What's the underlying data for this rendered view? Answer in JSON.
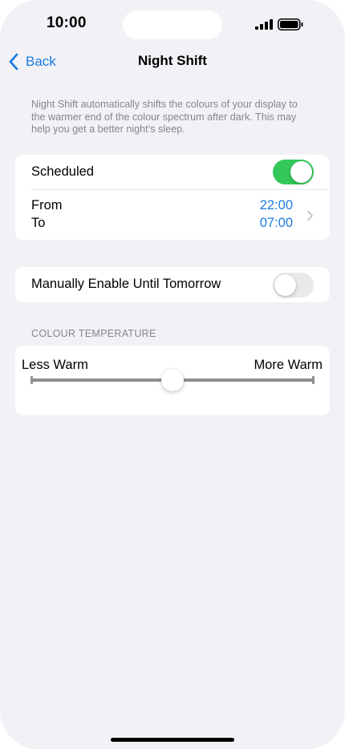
{
  "status_bar": {
    "time": "10:00"
  },
  "nav": {
    "back_label": "Back",
    "title": "Night Shift"
  },
  "description": "Night Shift automatically shifts the colours of your display to the warmer end of the colour spectrum after dark. This may help you get a better night’s sleep.",
  "schedule": {
    "label": "Scheduled",
    "enabled": true,
    "from_label": "From",
    "to_label": "To",
    "from_time": "22:00",
    "to_time": "07:00"
  },
  "manual": {
    "label": "Manually Enable Until Tomorrow",
    "enabled": false
  },
  "colour_temperature": {
    "header": "COLOUR TEMPERATURE",
    "min_label": "Less Warm",
    "max_label": "More Warm",
    "value_fraction": 0.5
  },
  "colors": {
    "accent": "#1a7ae0",
    "toggle_on": "#34c759",
    "toggle_off": "#e9e9ec",
    "background": "#f1f1f6",
    "secondary_text": "#85858b"
  },
  "icons": {
    "back": "chevron-left-icon",
    "disclosure": "chevron-right-icon",
    "signal": "cellular-signal-icon",
    "battery": "battery-icon"
  }
}
